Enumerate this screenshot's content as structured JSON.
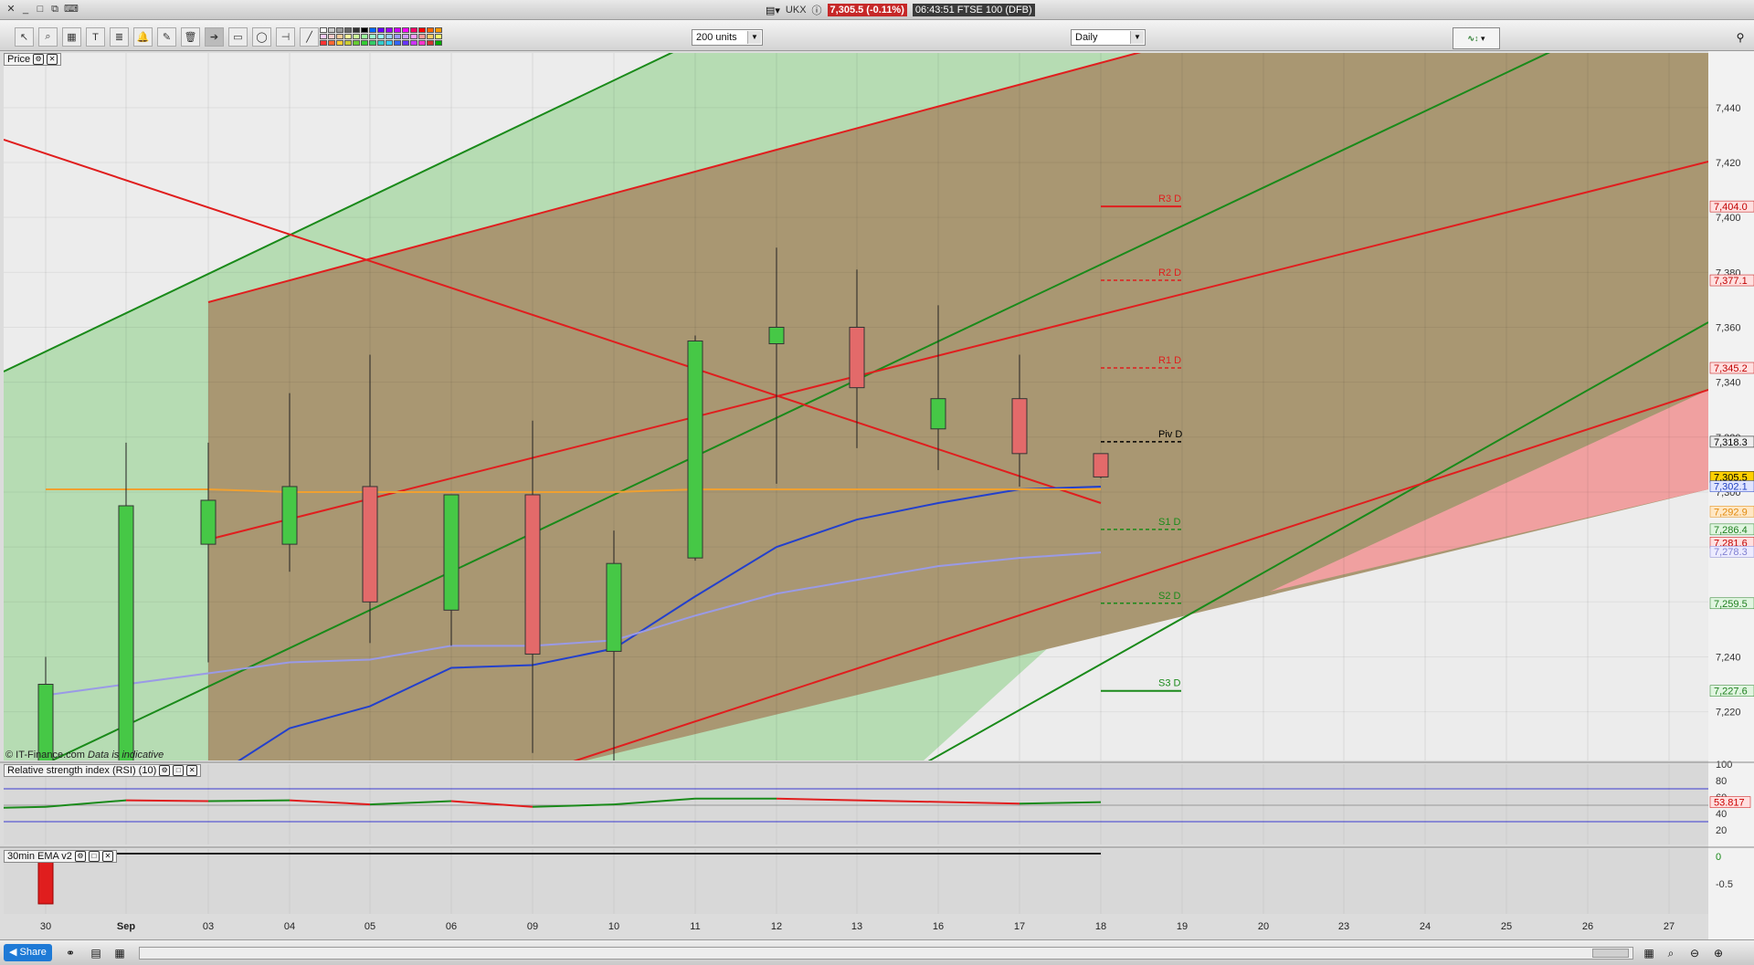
{
  "window": {
    "symbol": "UKX",
    "price_badge": "7,305.5 (-0.11%)",
    "info": "06:43:51 FTSE 100 (DFB)"
  },
  "toolbar": {
    "tools": [
      "pointer-icon",
      "zoom-icon",
      "chart-style-icon",
      "text-icon",
      "fib-icon",
      "alert-icon",
      "draw-icon",
      "trash-icon",
      "arrow-icon",
      "rectangle-icon",
      "ellipse-icon",
      "hline-icon",
      "line-icon"
    ],
    "units_select": "200 units",
    "period_select": "Daily"
  },
  "colors": {
    "up": "#46c846",
    "down": "#e36a6a",
    "green_line": "#1a8a1a",
    "red_line": "#e01e1e",
    "blue_ma": "#2340cc",
    "lavender_ma": "#9a9ae6",
    "orange_ma": "#f0a030"
  },
  "price_panel": {
    "label": "Price"
  },
  "copyright": {
    "text": "© IT-Finance.com",
    "note": "Data is indicative"
  },
  "rsi_panel": {
    "label": "Relative strength index (RSI) (10)",
    "axis": [
      "100",
      "80",
      "60",
      "40",
      "20"
    ],
    "value": "53.817"
  },
  "ema_panel": {
    "label": "30min EMA v2",
    "axis": [
      "0",
      "-0.5"
    ]
  },
  "xaxis": [
    "30",
    "Sep",
    "03",
    "04",
    "05",
    "06",
    "09",
    "10",
    "11",
    "12",
    "13",
    "16",
    "17",
    "18",
    "19",
    "20",
    "23",
    "24",
    "25",
    "26",
    "27"
  ],
  "chart_data": {
    "type": "candlestick",
    "y_ticks": [
      7220,
      7240,
      7260,
      7280,
      7300,
      7320,
      7340,
      7360,
      7380,
      7400,
      7420,
      7440
    ],
    "y_tick_labels": [
      "7,220",
      "7,240",
      "7,260",
      "7,280",
      "7,300",
      "7,320",
      "7,340",
      "7,360",
      "7,380",
      "7,400",
      "7,420",
      "7,440"
    ],
    "candles": [
      {
        "x": "30",
        "open": 7190,
        "high": 7240,
        "low": 7190,
        "close": 7230
      },
      {
        "x": "Sep",
        "open": 7190,
        "high": 7318,
        "low": 7190,
        "close": 7295
      },
      {
        "x": "03",
        "open": 7281,
        "high": 7318,
        "low": 7238,
        "close": 7297
      },
      {
        "x": "04",
        "open": 7281,
        "high": 7336,
        "low": 7271,
        "close": 7302
      },
      {
        "x": "05",
        "open": 7302,
        "high": 7350,
        "low": 7245,
        "close": 7260
      },
      {
        "x": "06",
        "open": 7257,
        "high": 7299,
        "low": 7244,
        "close": 7299
      },
      {
        "x": "09",
        "open": 7299,
        "high": 7326,
        "low": 7205,
        "close": 7241
      },
      {
        "x": "10",
        "open": 7242,
        "high": 7286,
        "low": 7190,
        "close": 7274
      },
      {
        "x": "11",
        "open": 7276,
        "high": 7357,
        "low": 7275,
        "close": 7355
      },
      {
        "x": "12",
        "open": 7354,
        "high": 7389,
        "low": 7303,
        "close": 7360
      },
      {
        "x": "13",
        "open": 7360,
        "high": 7381,
        "low": 7316,
        "close": 7338
      },
      {
        "x": "16",
        "open": 7323,
        "high": 7368,
        "low": 7308,
        "close": 7334
      },
      {
        "x": "17",
        "open": 7334,
        "high": 7350,
        "low": 7302,
        "close": 7314
      },
      {
        "x": "18",
        "open": 7314,
        "high": 7314,
        "low": 7305,
        "close": 7305.5
      }
    ],
    "moving_averages": [
      {
        "color": "blue",
        "values": [
          7170,
          7180,
          7195,
          7214,
          7222,
          7236,
          7237,
          7243,
          7262,
          7280,
          7290,
          7296,
          7301,
          7302
        ]
      },
      {
        "color": "lavender",
        "values": [
          7226,
          7230,
          7234,
          7238,
          7239,
          7244,
          7244,
          7246,
          7255,
          7263,
          7268,
          7273,
          7276,
          7278
        ]
      },
      {
        "color": "orange",
        "values": [
          7301,
          7301,
          7301,
          7300,
          7300,
          7300,
          7300,
          7300,
          7301,
          7301,
          7301,
          7301,
          7301,
          7301
        ]
      }
    ],
    "pivots": [
      {
        "label": "R3 D",
        "value": 7404.0,
        "style": "solid",
        "color": "red"
      },
      {
        "label": "R2 D",
        "value": 7377.1,
        "style": "dashed",
        "color": "red"
      },
      {
        "label": "R1 D",
        "value": 7345.2,
        "style": "dashed",
        "color": "red"
      },
      {
        "label": "Piv D",
        "value": 7318.3,
        "style": "dashed",
        "color": "black"
      },
      {
        "label": "S1 D",
        "value": 7286.4,
        "style": "dashed",
        "color": "green"
      },
      {
        "label": "S2 D",
        "value": 7259.5,
        "style": "dashed",
        "color": "green"
      },
      {
        "label": "S3 D",
        "value": 7227.6,
        "style": "solid",
        "color": "green"
      }
    ],
    "right_price_labels": [
      {
        "text": "7,404.0",
        "value": 7404.0,
        "bg": "#ffe0e0",
        "fg": "#c00000"
      },
      {
        "text": "7,377.1",
        "value": 7377.1,
        "bg": "#ffe0e0",
        "fg": "#c00000"
      },
      {
        "text": "7,345.2",
        "value": 7345.2,
        "bg": "#ffe0e0",
        "fg": "#c00000"
      },
      {
        "text": "7,318.3",
        "value": 7318.3,
        "bg": "#eeeeee",
        "fg": "#000000"
      },
      {
        "text": "7,305.5",
        "value": 7305.5,
        "bg": "#ffd000",
        "fg": "#000000"
      },
      {
        "text": "7,302.1",
        "value": 7302.1,
        "bg": "#dfe4ff",
        "fg": "#1f3fbf"
      },
      {
        "text": "7,292.9",
        "value": 7292.9,
        "bg": "#ffe7c4",
        "fg": "#e08a10"
      },
      {
        "text": "7,286.4",
        "value": 7286.4,
        "bg": "#e0f5e0",
        "fg": "#1f7f1f"
      },
      {
        "text": "7,281.6",
        "value": 7281.6,
        "bg": "#ffe0e0",
        "fg": "#c00000"
      },
      {
        "text": "7,278.3",
        "value": 7278.3,
        "bg": "#ecebff",
        "fg": "#7f7fd0"
      },
      {
        "text": "7,259.5",
        "value": 7259.5,
        "bg": "#e0f5e0",
        "fg": "#1f7f1f"
      },
      {
        "text": "7,227.6",
        "value": 7227.6,
        "bg": "#e0f5e0",
        "fg": "#1f7f1f"
      }
    ],
    "rsi_values": [
      48,
      56,
      55,
      56,
      51,
      55,
      48,
      51,
      58,
      58,
      56,
      54,
      52,
      53.8
    ]
  },
  "bottom": {
    "share_label": "Share"
  }
}
